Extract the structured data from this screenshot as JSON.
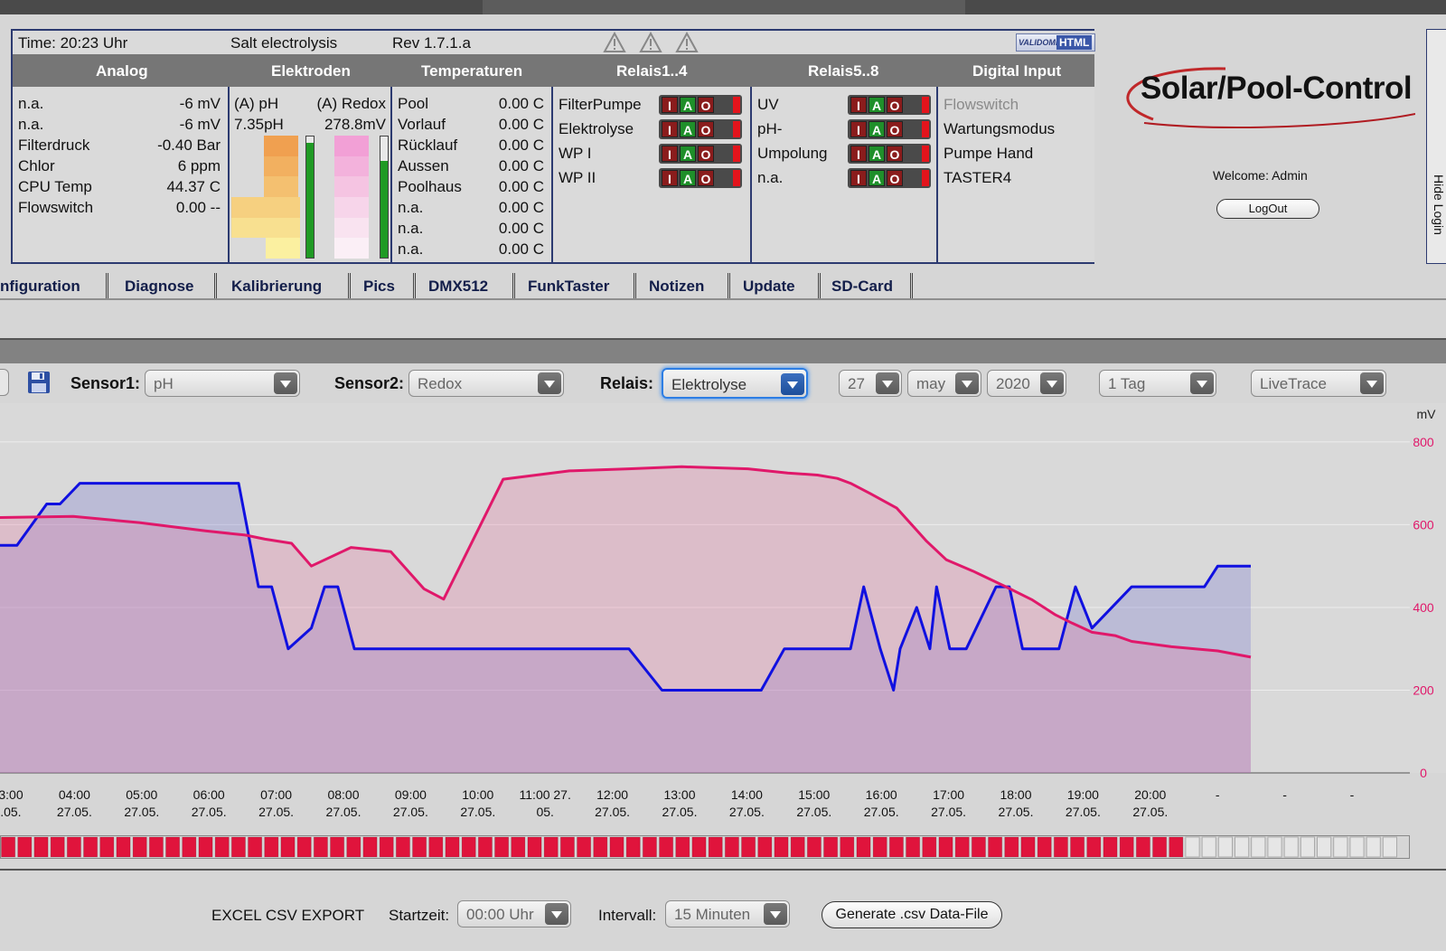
{
  "status_bar": {
    "time": "Time: 20:23 Uhr",
    "mode": "Salt electrolysis",
    "revision": "Rev 1.7.1.a",
    "validator_badge_left": "VALIDOME",
    "validator_badge_right": "HTML"
  },
  "columns": [
    "Analog",
    "Elektroden",
    "Temperaturen",
    "Relais1..4",
    "Relais5..8",
    "Digital Input"
  ],
  "analog": [
    {
      "label": "n.a.",
      "value": "-6 mV"
    },
    {
      "label": "n.a.",
      "value": "-6 mV"
    },
    {
      "label": "Filterdruck",
      "value": "-0.40 Bar"
    },
    {
      "label": "Chlor",
      "value": "6 ppm"
    },
    {
      "label": "CPU Temp",
      "value": "44.37 C"
    },
    {
      "label": "Flowswitch",
      "value": "0.00 --"
    }
  ],
  "electrodes": {
    "ph_label": "(A) pH",
    "ph_value": "7.35pH",
    "redox_label": "(A) Redox",
    "redox_value": "278.8mV",
    "ph_level": 0.95,
    "redox_level": 0.8,
    "ph_colors": [
      "#f0a050",
      "#f2b060",
      "#f4c070",
      "#f6d080",
      "#f8e090",
      "#fbf0a0"
    ],
    "redox_colors": [
      "#f2a0d6",
      "#f3b2dc",
      "#f5c4e2",
      "#f7d5ea",
      "#f9e3f0",
      "#fbeff6"
    ]
  },
  "temperatures": [
    {
      "label": "Pool",
      "value": "0.00 C"
    },
    {
      "label": "Vorlauf",
      "value": "0.00 C"
    },
    {
      "label": "Rücklauf",
      "value": "0.00 C"
    },
    {
      "label": "Aussen",
      "value": "0.00 C"
    },
    {
      "label": "Poolhaus",
      "value": "0.00 C"
    },
    {
      "label": "n.a.",
      "value": "0.00 C"
    },
    {
      "label": "n.a.",
      "value": "0.00 C"
    },
    {
      "label": "n.a.",
      "value": "0.00 C"
    }
  ],
  "relays_1_4": [
    "FilterPumpe",
    "Elektrolyse",
    "WP I",
    "WP II"
  ],
  "relays_5_8": [
    "UV",
    "pH-",
    "Umpolung",
    "n.a."
  ],
  "relay_buttons": {
    "i": "I",
    "a": "A",
    "o": "O"
  },
  "digital_inputs": [
    {
      "label": "Flowswitch",
      "active": false
    },
    {
      "label": "Wartungsmodus",
      "active": true
    },
    {
      "label": "Pumpe Hand",
      "active": true
    },
    {
      "label": "TASTER4",
      "active": true
    }
  ],
  "logo": {
    "text": "Solar/Pool-Control"
  },
  "login": {
    "welcome": "Welcome:  Admin",
    "logout": "LogOut",
    "hide": "Hide Login"
  },
  "nav_tabs": [
    "nfiguration",
    "Diagnose",
    "Kalibrierung",
    "Pics",
    "DMX512",
    "FunkTaster",
    "Notizen",
    "Update",
    "SD-Card"
  ],
  "toolbar": {
    "sensor1_label": "Sensor1:",
    "sensor1_value": "pH",
    "sensor2_label": "Sensor2:",
    "sensor2_value": "Redox",
    "relais_label": "Relais:",
    "relais_value": "Elektrolyse",
    "day": "27",
    "month": "may",
    "year": "2020",
    "range": "1 Tag",
    "mode": "LiveTrace"
  },
  "colors": {
    "sensor1": "#1010e0",
    "sensor2": "#e0186a",
    "led_on": "#2ec82e",
    "led_off": "#e0143c"
  },
  "chart_data": {
    "type": "line",
    "y_unit": "mV",
    "y_ticks_right": [
      "800",
      "600",
      "400",
      "200",
      "0"
    ],
    "ylim": [
      0,
      850
    ],
    "x_labels": [
      [
        "3:00",
        "7.05."
      ],
      [
        "04:00",
        "27.05."
      ],
      [
        "05:00",
        "27.05."
      ],
      [
        "06:00",
        "27.05."
      ],
      [
        "07:00",
        "27.05."
      ],
      [
        "08:00",
        "27.05."
      ],
      [
        "09:00",
        "27.05."
      ],
      [
        "10:00",
        "27.05."
      ],
      [
        "11:00 27.",
        "05."
      ],
      [
        "12:00",
        "27.05."
      ],
      [
        "13:00",
        "27.05."
      ],
      [
        "14:00",
        "27.05."
      ],
      [
        "15:00",
        "27.05."
      ],
      [
        "16:00",
        "27.05."
      ],
      [
        "17:00",
        "27.05."
      ],
      [
        "18:00",
        "27.05."
      ],
      [
        "19:00",
        "27.05."
      ],
      [
        "20:00",
        "27.05."
      ],
      [
        "-",
        ""
      ],
      [
        "-",
        ""
      ],
      [
        "-",
        ""
      ]
    ],
    "series": [
      {
        "key": "sensor1",
        "hours": [
          2.0,
          3.15,
          3.6,
          3.8,
          4.1,
          6.5,
          6.8,
          7.0,
          7.25,
          7.6,
          7.8,
          8.0,
          8.25,
          12.4,
          12.9,
          14.4,
          14.75,
          15.75,
          15.95,
          16.2,
          16.4,
          16.5,
          16.75,
          16.95,
          17.05,
          17.25,
          17.5,
          17.95,
          18.15,
          18.35,
          18.9,
          19.15,
          19.4,
          20.0,
          20.9,
          21.1,
          21.3,
          21.8
        ],
        "values": [
          550,
          550,
          650,
          650,
          700,
          700,
          450,
          450,
          300,
          350,
          450,
          450,
          300,
          300,
          200,
          200,
          300,
          300,
          450,
          300,
          200,
          300,
          400,
          300,
          450,
          300,
          300,
          450,
          450,
          300,
          300,
          450,
          350,
          450,
          450,
          450,
          500,
          500
        ]
      },
      {
        "key": "sensor2",
        "hours": [
          2.0,
          4.0,
          5.0,
          6.0,
          6.6,
          6.9,
          7.3,
          7.6,
          8.2,
          8.5,
          8.8,
          9.3,
          9.6,
          10.5,
          11.5,
          12.4,
          13.2,
          14.2,
          14.8,
          15.25,
          15.55,
          15.75,
          16.05,
          16.45,
          16.9,
          17.2,
          17.6,
          18.1,
          18.5,
          18.85,
          19.1,
          19.4,
          19.75,
          20.0,
          20.6,
          21.3,
          21.8
        ],
        "values": [
          615,
          620,
          605,
          585,
          575,
          565,
          555,
          500,
          545,
          540,
          535,
          445,
          420,
          710,
          730,
          735,
          740,
          735,
          725,
          720,
          712,
          700,
          675,
          640,
          560,
          515,
          488,
          450,
          418,
          382,
          362,
          340,
          332,
          318,
          305,
          295,
          280
        ]
      }
    ],
    "x_hour_start": 2.5,
    "x_hour_end": 23.5,
    "relay_state_per_quarter": "0000000000000000000000000000000000000000000000000000000000000000000000000000000000000001111111111111111111111110000000000000000000000000000000000000000000000000000000000000000000000000000000000000000000000000000000000000000000000000000000000000"
  },
  "export": {
    "title": "EXCEL CSV EXPORT",
    "start_label": "Startzeit:",
    "start_value": "00:00 Uhr",
    "interval_label": "Intervall:",
    "interval_value": "15 Minuten",
    "generate": "Generate .csv Data-File"
  }
}
